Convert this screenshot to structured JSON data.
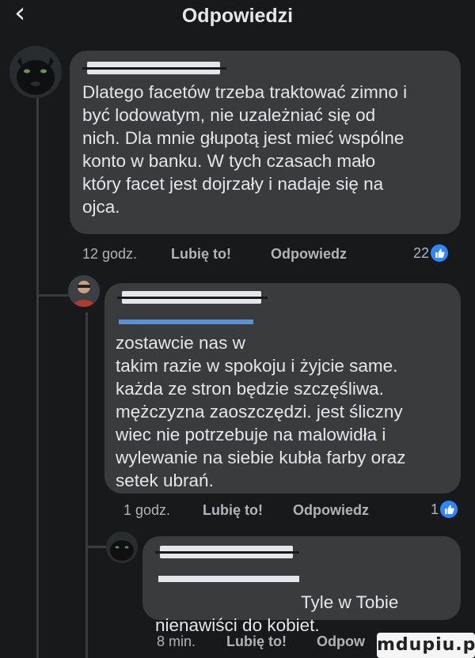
{
  "header": {
    "title": "Odpowiedzi",
    "back_icon": "‹"
  },
  "comments": [
    {
      "text": "Dlatego facetów trzeba traktować zimno i\nbyć lodowatym, nie uzależniać się od\nnich. Dla mnie głupotą jest mieć wspólne\nkonto w banku. W tych czasach mało\nktóry facet jest dojrzały i nadaje się na\nojca.",
      "time": "12 godz.",
      "like": "Lubię to!",
      "reply": "Odpowiedz",
      "reactions": "22"
    },
    {
      "text": "zostawcie nas w\ntakim razie w spokoju i żyjcie same.\nkażda ze stron będzie szczęśliwa.\nmężczyzna zaoszczędzi. jest śliczny\nwiec nie potrzebuje na malowidła i\nwylewanie na siebie kubła farby oraz\nsetek ubrań.",
      "time": "1 godz.",
      "like": "Lubię to!",
      "reply": "Odpowiedz",
      "reactions": "1"
    },
    {
      "text_suffix": "Tyle w Tobie",
      "text_line2": "nienawiści do kobiet.",
      "time": "8 min.",
      "like": "Lubię to!",
      "reply": "Odpow"
    }
  ],
  "watermark": "mdupiu.pl",
  "colors": {
    "background": "#18191a",
    "bubble": "#3a3b3c",
    "text": "#e4e6eb",
    "meta": "#b0b3b8",
    "like_blue": "#2d88ff",
    "mention_blue": "#5b8fd6"
  }
}
